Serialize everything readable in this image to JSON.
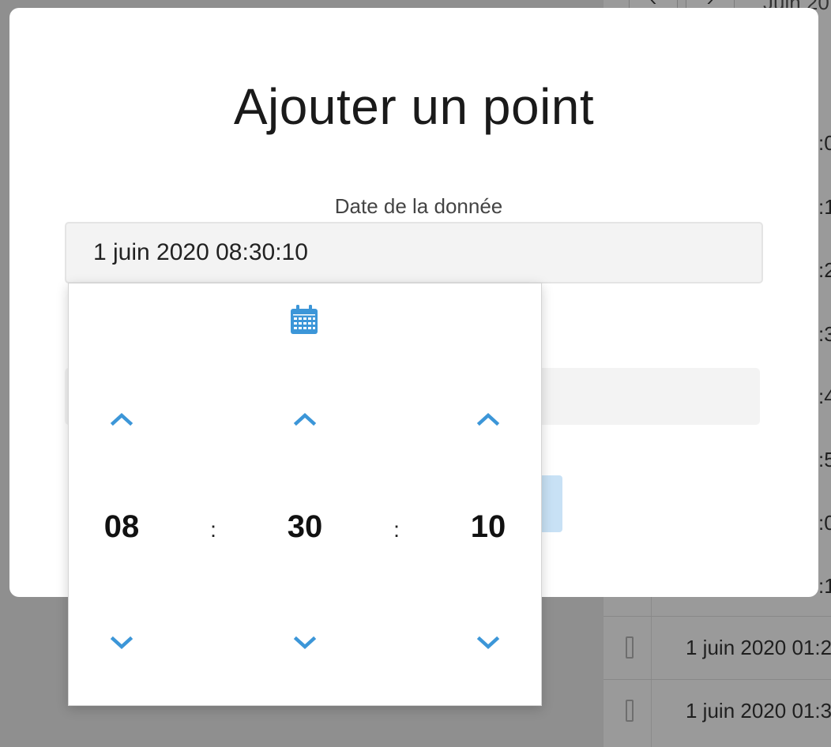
{
  "modal": {
    "title": "Ajouter un point",
    "date_field": {
      "label": "Date de la donnée",
      "value": "1 juin 2020 08:30:10"
    }
  },
  "time_picker": {
    "hours": "08",
    "minutes": "30",
    "seconds": "10",
    "separator": ":",
    "accent_color": "#3c96d8",
    "icons": [
      "calendar-icon",
      "chevron-up-icon",
      "chevron-down-icon"
    ]
  },
  "background": {
    "nav_prev": "‹",
    "nav_next": "›",
    "header_text": "Juin 20",
    "row_fragments": [
      ":0",
      ":1",
      ":2",
      ":3",
      ":4",
      ":5",
      ":0",
      ":1"
    ],
    "rows": [
      {
        "text": "1 juin 2020 01:2"
      },
      {
        "text": "1 juin 2020 01:3"
      }
    ]
  }
}
